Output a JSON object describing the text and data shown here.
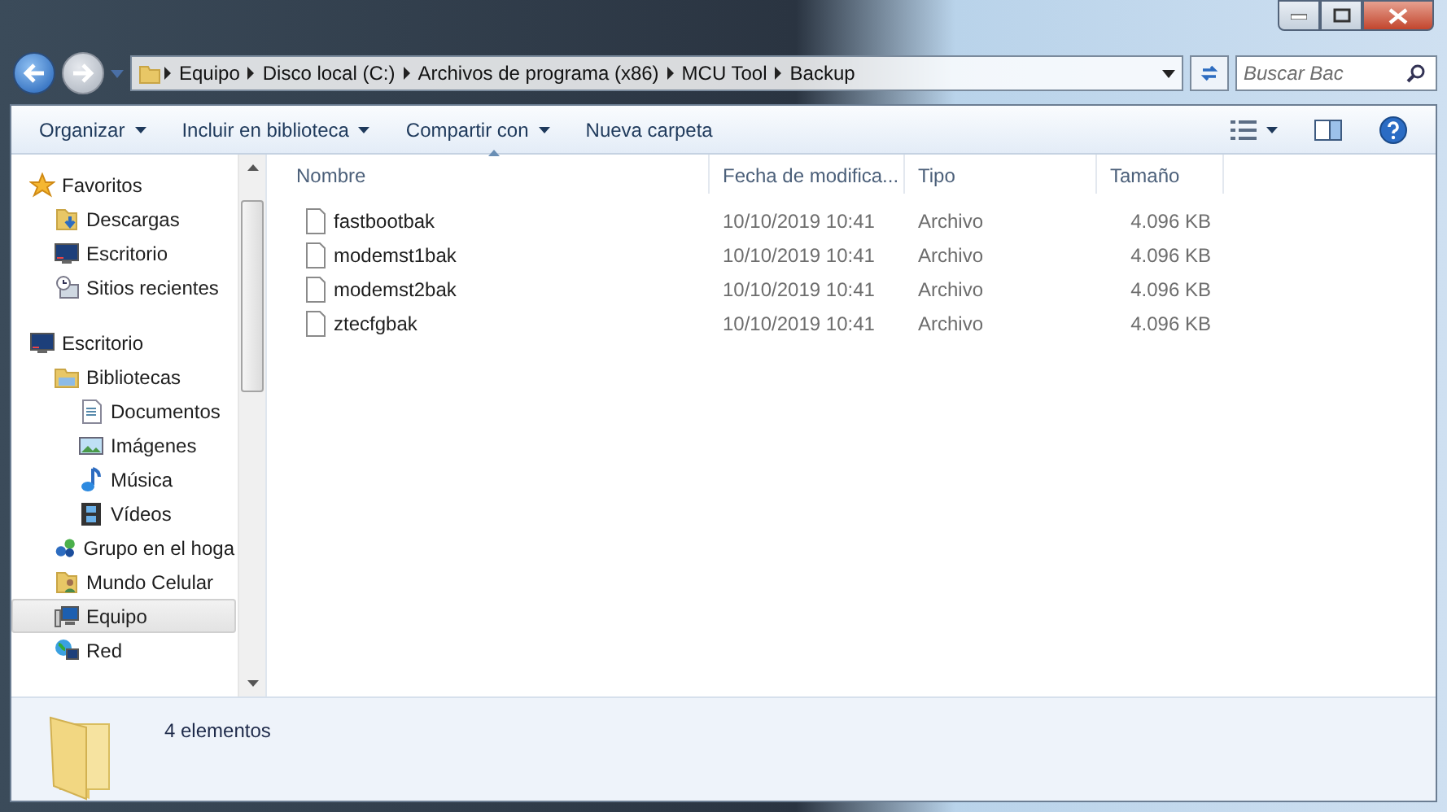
{
  "address_bar": {
    "crumbs": [
      "Equipo",
      "Disco local (C:)",
      "Archivos de programa (x86)",
      "MCU Tool",
      "Backup"
    ]
  },
  "search": {
    "placeholder": "Buscar Bac"
  },
  "toolbar": {
    "buttons": [
      {
        "label": "Organizar",
        "dropdown": true
      },
      {
        "label": "Incluir en biblioteca",
        "dropdown": true
      },
      {
        "label": "Compartir con",
        "dropdown": true
      },
      {
        "label": "Nueva carpeta",
        "dropdown": false
      }
    ]
  },
  "sidebar": {
    "items": [
      {
        "label": "Favoritos",
        "kind": "star",
        "selected": false,
        "children": [
          {
            "label": "Descargas",
            "kind": "download",
            "selected": false
          },
          {
            "label": "Escritorio",
            "kind": "desktop",
            "selected": false
          },
          {
            "label": "Sitios recientes",
            "kind": "recent",
            "selected": false
          }
        ]
      },
      {
        "label": "Escritorio",
        "kind": "desktop",
        "selected": false,
        "children": [
          {
            "label": "Bibliotecas",
            "kind": "library",
            "selected": false,
            "children": [
              {
                "label": "Documentos",
                "kind": "document",
                "selected": false
              },
              {
                "label": "Imágenes",
                "kind": "image",
                "selected": false
              },
              {
                "label": "Música",
                "kind": "music",
                "selected": false
              },
              {
                "label": "Vídeos",
                "kind": "video",
                "selected": false
              }
            ]
          },
          {
            "label": "Grupo en el hoga",
            "kind": "homegroup",
            "selected": false
          },
          {
            "label": "Mundo Celular",
            "kind": "userfolder",
            "selected": false
          },
          {
            "label": "Equipo",
            "kind": "computer",
            "selected": true
          },
          {
            "label": "Red",
            "kind": "network",
            "selected": false
          }
        ]
      }
    ]
  },
  "table": {
    "columns": [
      {
        "label": "Nombre",
        "sorted": true
      },
      {
        "label": "Fecha de modifica...",
        "sorted": false
      },
      {
        "label": "Tipo",
        "sorted": false
      },
      {
        "label": "Tamaño",
        "sorted": false
      }
    ],
    "rows": [
      [
        "fastbootbak",
        "10/10/2019 10:41",
        "Archivo",
        "4.096 KB"
      ],
      [
        "modemst1bak",
        "10/10/2019 10:41",
        "Archivo",
        "4.096 KB"
      ],
      [
        "modemst2bak",
        "10/10/2019 10:41",
        "Archivo",
        "4.096 KB"
      ],
      [
        "ztecfgbak",
        "10/10/2019 10:41",
        "Archivo",
        "4.096 KB"
      ]
    ]
  },
  "status_bar": {
    "text": "4 elementos"
  }
}
